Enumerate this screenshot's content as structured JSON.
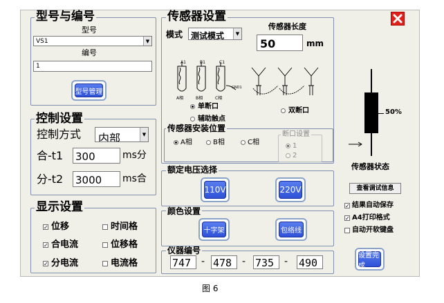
{
  "model_group": {
    "title": "型号与编号",
    "model_label": "型号",
    "model_value": "VS1",
    "number_label": "编号",
    "number_value": "1",
    "manage_button": "型号管理"
  },
  "control_group": {
    "title": "控制设置",
    "mode_label": "控制方式",
    "mode_value": "内部",
    "t1_label": "合-t1",
    "t1_value": "300",
    "t1_unit": "ms分",
    "t2_label": "分-t2",
    "t2_value": "3000",
    "t2_unit": "ms合"
  },
  "display_group": {
    "title": "显示设置",
    "items": [
      {
        "label": "位移",
        "checked": true
      },
      {
        "label": "时间格",
        "checked": false
      },
      {
        "label": "合电流",
        "checked": true
      },
      {
        "label": "位移格",
        "checked": false
      },
      {
        "label": "分电流",
        "checked": true
      },
      {
        "label": "电流格",
        "checked": false
      }
    ]
  },
  "sensor_group": {
    "title": "传感器设置",
    "mode_label": "模式",
    "mode_value": "测试模式",
    "length_label": "传感器长度",
    "length_value": "50",
    "length_unit": "mm",
    "diagram_labels": [
      "A1",
      "B1",
      "C1",
      "A相",
      "B相",
      "C相",
      "GND1"
    ],
    "single_break": "单断口",
    "aux_contact": "辅助触点",
    "double_break": "双断口"
  },
  "mount_group": {
    "title": "传感器安装位置",
    "phases": [
      "A相",
      "B相",
      "C相"
    ],
    "break_title": "断口设置",
    "break_options": [
      "1",
      "2"
    ]
  },
  "voltage_group": {
    "title": "额定电压选择",
    "btn_110": "110V",
    "btn_220": "220V"
  },
  "color_group": {
    "title": "颜色设置",
    "btn_cross": "十字架",
    "btn_envelope": "包络线"
  },
  "instrument_group": {
    "title": "仪器编号",
    "parts": [
      "747",
      "478",
      "735",
      "490"
    ],
    "sep": "-"
  },
  "sensor_status": {
    "level": 0.5,
    "percent_label": "50%",
    "label": "传感器状态"
  },
  "right_panel": {
    "debug_button": "查看调试信息",
    "options": [
      {
        "label": "结果自动保存",
        "checked": true
      },
      {
        "label": "A4打印格式",
        "checked": true
      },
      {
        "label": "自动开软键盘",
        "checked": false
      }
    ],
    "done_button": "设置完成"
  },
  "caption": "图 6"
}
